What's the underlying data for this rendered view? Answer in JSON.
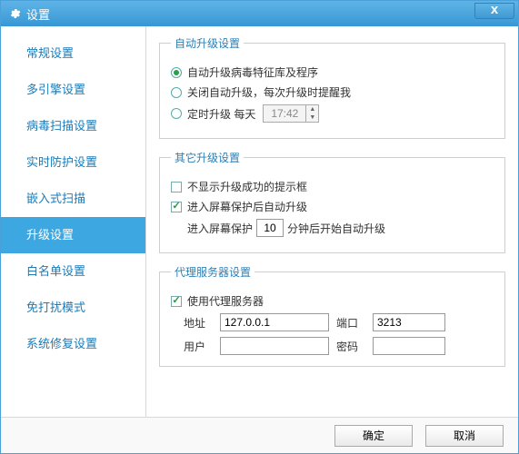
{
  "window": {
    "title": "设置"
  },
  "sidebar": {
    "items": [
      {
        "label": "常规设置"
      },
      {
        "label": "多引擎设置"
      },
      {
        "label": "病毒扫描设置"
      },
      {
        "label": "实时防护设置"
      },
      {
        "label": "嵌入式扫描"
      },
      {
        "label": "升级设置"
      },
      {
        "label": "白名单设置"
      },
      {
        "label": "免打扰模式"
      },
      {
        "label": "系统修复设置"
      }
    ],
    "active_index": 5
  },
  "auto_upgrade": {
    "legend": "自动升级设置",
    "opt1": "自动升级病毒特征库及程序",
    "opt2": "关闭自动升级，每次升级时提醒我",
    "opt3_prefix": "定时升级 每天",
    "time_value": "17:42",
    "selected": 0
  },
  "other_upgrade": {
    "legend": "其它升级设置",
    "chk1": "不显示升级成功的提示框",
    "chk1_checked": false,
    "chk2": "进入屏幕保护后自动升级",
    "chk2_checked": true,
    "ss_prefix": "进入屏幕保护",
    "ss_value": "10",
    "ss_suffix": "分钟后开始自动升级"
  },
  "proxy": {
    "legend": "代理服务器设置",
    "use_label": "使用代理服务器",
    "use_checked": true,
    "addr_label": "地址",
    "addr_value": "127.0.0.1",
    "port_label": "端口",
    "port_value": "3213",
    "user_label": "用户",
    "user_value": "",
    "pass_label": "密码",
    "pass_value": ""
  },
  "footer": {
    "ok": "确定",
    "cancel": "取消"
  }
}
